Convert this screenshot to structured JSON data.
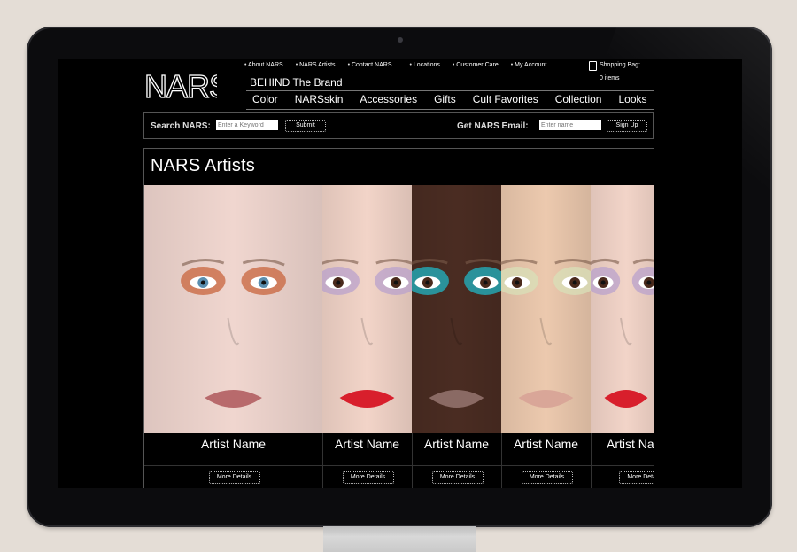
{
  "site": {
    "logo_text": "NARS",
    "top_nav": [
      "About NARS",
      "NARS Artists",
      "Contact NARS",
      "Locations",
      "Customer Care",
      "My Account"
    ],
    "shopping_bag": {
      "label": "Shopping Bag:",
      "count": "0 items"
    },
    "tagline": "BEHIND The Brand",
    "main_nav": [
      "Color",
      "NARSskin",
      "Accessories",
      "Gifts",
      "Cult Favorites",
      "Collection",
      "Looks"
    ]
  },
  "search": {
    "label": "Search NARS:",
    "placeholder": "Enter a Keyword",
    "submit_label": "Submit"
  },
  "email": {
    "label": "Get NARS Email:",
    "placeholder": "Enter name",
    "signup_label": "Sign Up"
  },
  "artists": {
    "title": "NARS Artists",
    "cards": [
      {
        "name": "Artist Name",
        "button": "More Details",
        "skin": "#f0d6cf",
        "eyeshadow": "#c8643c",
        "lips": "#b86a6c"
      },
      {
        "name": "Artist Name",
        "button": "More Details",
        "skin": "#f2d4c8",
        "eyeshadow": "#b9a2cc",
        "lips": "#d81f2c"
      },
      {
        "name": "Artist Name",
        "button": "More Details",
        "skin": "#4a2c22",
        "eyeshadow": "#20b6c4",
        "lips": "#8a6a64"
      },
      {
        "name": "Artist Name",
        "button": "More Details",
        "skin": "#ecc9ae",
        "eyeshadow": "#d8e0b8",
        "lips": "#d9a698"
      },
      {
        "name": "Artist Name",
        "button": "More Details",
        "skin": "#f2d4c8",
        "eyeshadow": "#b9a2cc",
        "lips": "#d81f2c"
      }
    ]
  }
}
